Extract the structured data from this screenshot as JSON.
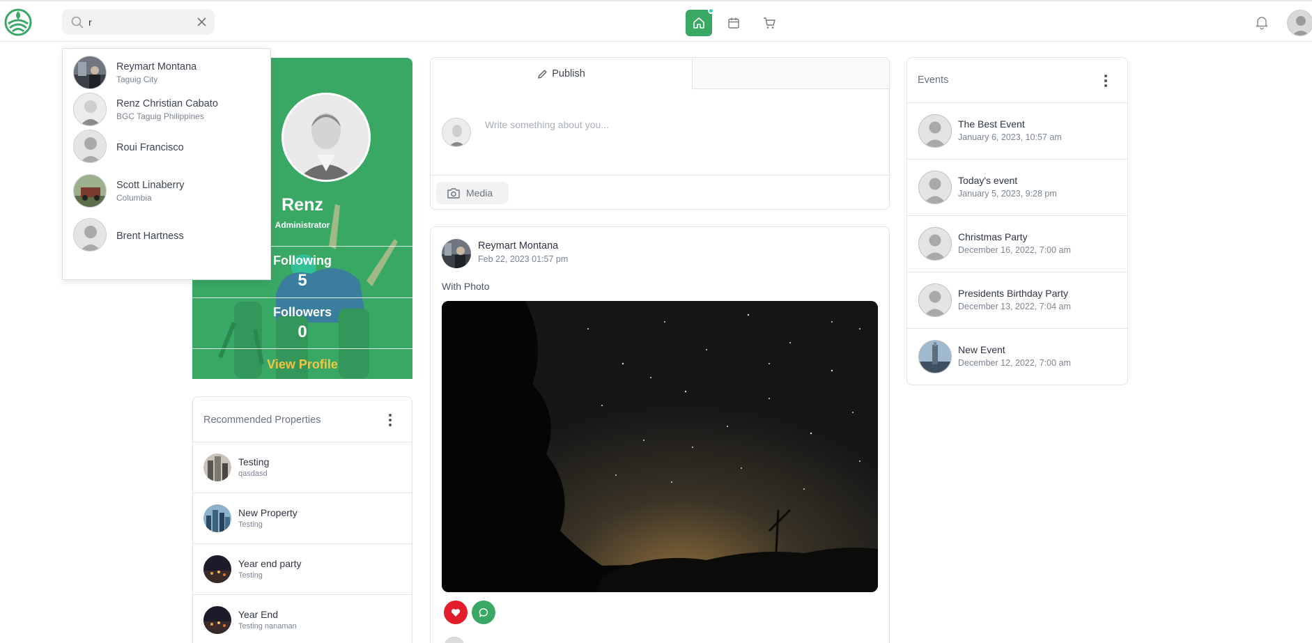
{
  "search": {
    "value": "r",
    "placeholder": ""
  },
  "search_results": [
    {
      "name": "Reymart Montana",
      "sub": "Taguig City"
    },
    {
      "name": "Renz Christian Cabato",
      "sub": "BGC Taguig Philippines"
    },
    {
      "name": "Roui Francisco",
      "sub": ""
    },
    {
      "name": "Scott Linaberry",
      "sub": "Columbia"
    },
    {
      "name": "Brent Hartness",
      "sub": ""
    }
  ],
  "profile": {
    "name": "Renz",
    "role": "Administrator",
    "following_label": "Following",
    "following": "5",
    "followers_label": "Followers",
    "followers": "0",
    "view_profile": "View Profile"
  },
  "recommended": {
    "title": "Recommended Properties",
    "items": [
      {
        "name": "Testing",
        "sub": "qasdasd"
      },
      {
        "name": "New Property",
        "sub": "Testing"
      },
      {
        "name": "Year end party",
        "sub": "Testing"
      },
      {
        "name": "Year End",
        "sub": "Testing nanaman"
      }
    ]
  },
  "composer": {
    "tab_label": "Publish",
    "placeholder": "Write something about you...",
    "media_label": "Media"
  },
  "post": {
    "author": "Reymart Montana",
    "date": "Feb 22, 2023 01:57 pm",
    "text": "With Photo"
  },
  "events": {
    "title": "Events",
    "items": [
      {
        "name": "The Best Event",
        "date": "January 6, 2023, 10:57 am"
      },
      {
        "name": "Today's event",
        "date": "January 5, 2023, 9:28 pm"
      },
      {
        "name": "Christmas Party",
        "date": "December 16, 2022, 7:00 am"
      },
      {
        "name": "Presidents Birthday Party",
        "date": "December 13, 2022, 7:04 am"
      },
      {
        "name": "New Event",
        "date": "December 12, 2022, 7:00 am"
      }
    ]
  },
  "colors": {
    "brand_green": "#3aa865",
    "accent_yellow": "#f5c542",
    "like_red": "#e11d2a"
  },
  "icons": [
    "logo-icon",
    "search-icon",
    "close-icon",
    "home-icon",
    "calendar-icon",
    "cart-icon",
    "bell-icon",
    "pencil-icon",
    "camera-icon",
    "heart-icon",
    "comment-icon",
    "kebab-icon"
  ]
}
